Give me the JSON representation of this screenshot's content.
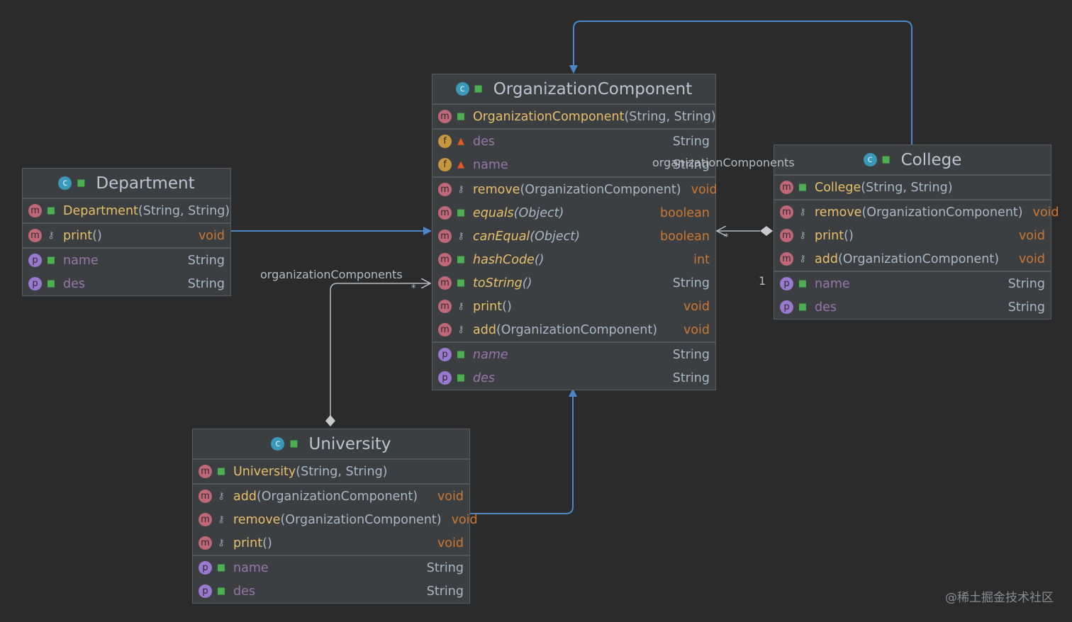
{
  "colors": {
    "background": "#2b2b2b",
    "box": "#3c3f41",
    "inheritance": "#4a88c7",
    "association": "#b8bcc0"
  },
  "classes": [
    {
      "id": "organization-component",
      "title": "OrganizationComponent",
      "kind": "abstract-class",
      "sections": [
        [
          {
            "icon": "m",
            "vis": "public",
            "name": "OrganizationComponent",
            "params": "(String, String)",
            "type": ""
          }
        ],
        [
          {
            "icon": "f",
            "vis": "private",
            "name": "des",
            "type": "String"
          },
          {
            "icon": "f",
            "vis": "private",
            "name": "name",
            "type": "String"
          }
        ],
        [
          {
            "icon": "m",
            "vis": "protected",
            "name": "remove",
            "params": "(OrganizationComponent)",
            "type": "void"
          },
          {
            "icon": "m",
            "vis": "public",
            "name": "equals",
            "params": "(Object)",
            "type": "boolean",
            "italic": true
          },
          {
            "icon": "m",
            "vis": "protected",
            "name": "canEqual",
            "params": "(Object)",
            "type": "boolean",
            "italic": true
          },
          {
            "icon": "m",
            "vis": "public",
            "name": "hashCode",
            "params": "()",
            "type": "int",
            "italic": true
          },
          {
            "icon": "m",
            "vis": "public",
            "name": "toString",
            "params": "()",
            "type": "String",
            "italic": true
          },
          {
            "icon": "m",
            "vis": "protected",
            "name": "print",
            "params": "()",
            "type": "void"
          },
          {
            "icon": "m",
            "vis": "protected",
            "name": "add",
            "params": "(OrganizationComponent)",
            "type": "void"
          }
        ],
        [
          {
            "icon": "p",
            "vis": "public",
            "name": "name",
            "type": "String",
            "italic": true
          },
          {
            "icon": "p",
            "vis": "public",
            "name": "des",
            "type": "String",
            "italic": true
          }
        ]
      ]
    },
    {
      "id": "department",
      "title": "Department",
      "kind": "class",
      "sections": [
        [
          {
            "icon": "m",
            "vis": "public",
            "name": "Department",
            "params": "(String, String)",
            "type": ""
          }
        ],
        [
          {
            "icon": "m",
            "vis": "protected",
            "name": "print",
            "params": "()",
            "type": "void"
          }
        ],
        [
          {
            "icon": "p",
            "vis": "public",
            "name": "name",
            "type": "String"
          },
          {
            "icon": "p",
            "vis": "public",
            "name": "des",
            "type": "String"
          }
        ]
      ]
    },
    {
      "id": "college",
      "title": "College",
      "kind": "class",
      "sections": [
        [
          {
            "icon": "m",
            "vis": "public",
            "name": "College",
            "params": "(String, String)",
            "type": ""
          }
        ],
        [
          {
            "icon": "m",
            "vis": "protected",
            "name": "remove",
            "params": "(OrganizationComponent)",
            "type": "void"
          },
          {
            "icon": "m",
            "vis": "protected",
            "name": "print",
            "params": "()",
            "type": "void"
          },
          {
            "icon": "m",
            "vis": "protected",
            "name": "add",
            "params": "(OrganizationComponent)",
            "type": "void"
          }
        ],
        [
          {
            "icon": "p",
            "vis": "public",
            "name": "name",
            "type": "String"
          },
          {
            "icon": "p",
            "vis": "public",
            "name": "des",
            "type": "String"
          }
        ]
      ]
    },
    {
      "id": "university",
      "title": "University",
      "kind": "class",
      "sections": [
        [
          {
            "icon": "m",
            "vis": "public",
            "name": "University",
            "params": "(String, String)",
            "type": ""
          }
        ],
        [
          {
            "icon": "m",
            "vis": "protected",
            "name": "add",
            "params": "(OrganizationComponent)",
            "type": "void"
          },
          {
            "icon": "m",
            "vis": "protected",
            "name": "remove",
            "params": "(OrganizationComponent)",
            "type": "void"
          },
          {
            "icon": "m",
            "vis": "protected",
            "name": "print",
            "params": "()",
            "type": "void"
          }
        ],
        [
          {
            "icon": "p",
            "vis": "public",
            "name": "name",
            "type": "String"
          },
          {
            "icon": "p",
            "vis": "public",
            "name": "des",
            "type": "String"
          }
        ]
      ]
    }
  ],
  "labels": {
    "uni_role": "organizationComponents",
    "uni_mult": "*",
    "col_role": "organizationComponents",
    "col_mult": "*",
    "col_one": "1"
  },
  "watermark": "@稀土掘金技术社区"
}
